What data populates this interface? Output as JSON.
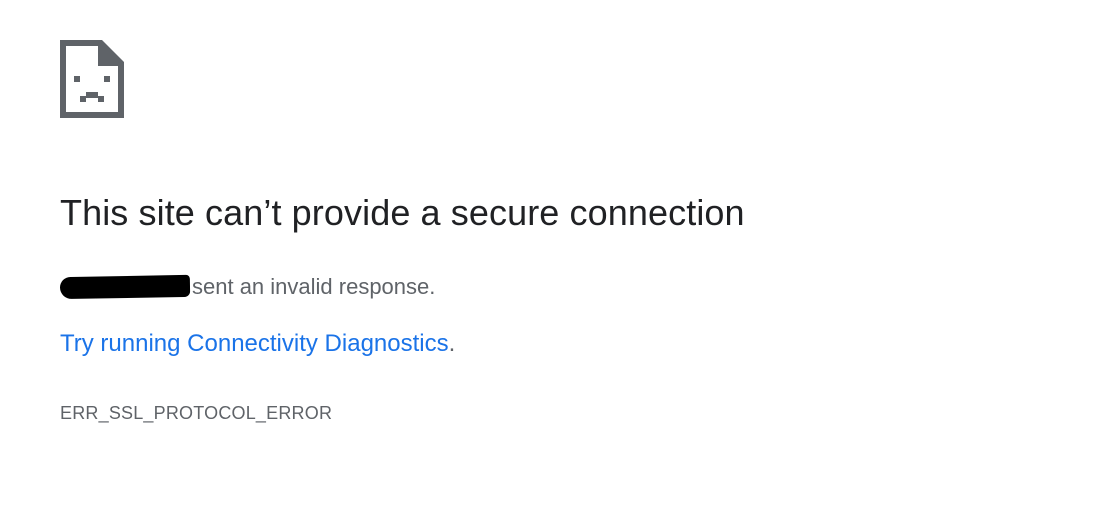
{
  "icon": "sad-page-icon",
  "colors": {
    "heading": "#202124",
    "body_text": "#5f6368",
    "link": "#1a73e8",
    "icon": "#5f6368"
  },
  "heading": "This site can’t provide a secure connection",
  "description": {
    "host_redacted": true,
    "text": "sent an invalid response."
  },
  "suggestion": {
    "link_text": "Try running Connectivity Diagnostics",
    "trailing": "."
  },
  "error_code": "ERR_SSL_PROTOCOL_ERROR"
}
